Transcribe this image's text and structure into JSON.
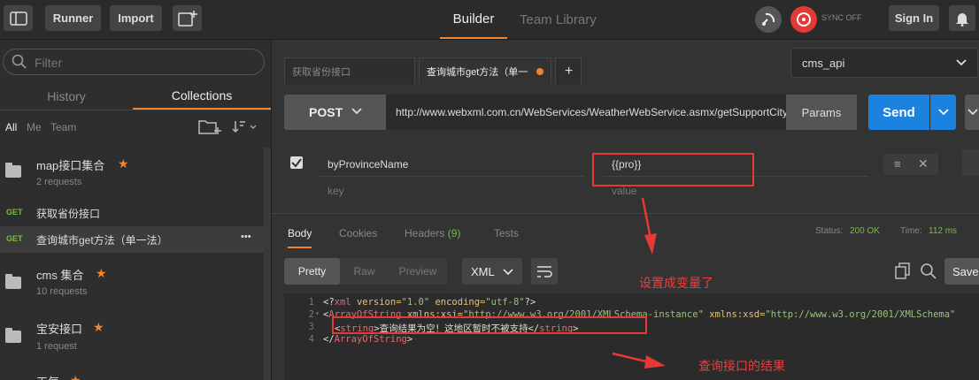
{
  "topbar": {
    "runner": "Runner",
    "import": "Import",
    "tab_builder": "Builder",
    "tab_team_library": "Team Library",
    "sync": "SYNC OFF",
    "sign_in": "Sign In"
  },
  "sidebar": {
    "filter_placeholder": "Filter",
    "tab_history": "History",
    "tab_collections": "Collections",
    "sub_all": "All",
    "sub_me": "Me",
    "sub_team": "Team",
    "collections": [
      {
        "name": "map接口集合",
        "meta": "2 requests"
      },
      {
        "name": "cms 集合",
        "meta": "10 requests"
      },
      {
        "name": "宝安接口",
        "meta": "1 request"
      },
      {
        "name": "天气"
      }
    ],
    "requests": [
      {
        "method": "GET",
        "name": "获取省份接口"
      },
      {
        "method": "GET",
        "name": "查询城市get方法（单一法）",
        "more": "•••"
      }
    ]
  },
  "tabs": {
    "tab1": "获取省份接口",
    "tab2": "查询城市get方法（单一",
    "add": "+"
  },
  "environment": "cms_api",
  "request": {
    "method": "POST",
    "url": "http://www.webxml.com.cn/WebServices/WeatherWebService.asmx/getSupportCity",
    "params": "Params",
    "send": "Send",
    "param_key": "byProvinceName",
    "param_value": "{{pro}}",
    "key_placeholder": "key",
    "value_placeholder": "value"
  },
  "response": {
    "tab_body": "Body",
    "tab_cookies": "Cookies",
    "tab_headers": "Headers",
    "headers_count": "(9)",
    "tab_tests": "Tests",
    "status_label": "Status:",
    "status_value": "200 OK",
    "time_label": "Time:",
    "time_value": "112 ms",
    "view_pretty": "Pretty",
    "view_raw": "Raw",
    "view_preview": "Preview",
    "format": "XML",
    "save": "Save",
    "lines": [
      "1",
      "2",
      "3",
      "4"
    ],
    "code": {
      "l1_a": "<?",
      "l1_b": "xml",
      "l1_c": " version=",
      "l1_d": "\"1.0\"",
      "l1_e": " encoding=",
      "l1_f": "\"utf-8\"",
      "l1_g": "?>",
      "l2_a": "<",
      "l2_b": "ArrayOfString",
      "l2_c": " xmlns:xsi=",
      "l2_d": "\"http://www.w3.org/2001/XMLSchema-instance\"",
      "l2_e": " xmlns:xsd=",
      "l2_f": "\"http://www.w3.org/2001/XMLSchema\"",
      "l3_a": "<",
      "l3_b": "string",
      "l3_c": ">查询结果为空！这地区暂时不被支持</",
      "l3_d": "string",
      "l3_e": ">",
      "l4_a": "</",
      "l4_b": "ArrayOfString",
      "l4_c": ">"
    }
  },
  "annotations": {
    "variable": "设置成变量了",
    "result": "查询接口的结果"
  }
}
